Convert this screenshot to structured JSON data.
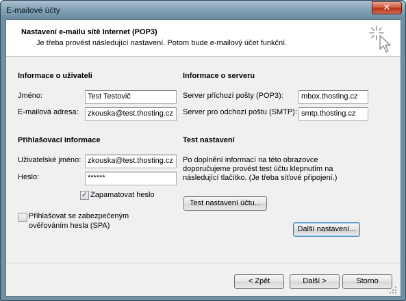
{
  "window": {
    "title": "E-mailové účty",
    "close_label": "✕"
  },
  "header": {
    "title": "Nastavení e-mailu sítě Internet (POP3)",
    "subtitle": "Je třeba provést následující nastavení. Potom bude e-mailový účet funkční."
  },
  "user_info": {
    "heading": "Informace o uživateli",
    "name_label": "Jméno:",
    "name_value": "Test Testovič",
    "email_label": "E-mailová adresa:",
    "email_value": "zkouska@test.thosting.cz"
  },
  "server_info": {
    "heading": "Informace o serveru",
    "incoming_label": "Server příchozí pošty (POP3):",
    "incoming_value": "mbox.thosting.cz",
    "outgoing_label": "Server pro odchozí poštu (SMTP):",
    "outgoing_value": "smtp.thosting.cz"
  },
  "login_info": {
    "heading": "Přihlašovací informace",
    "username_label": "Uživatelské jméno:",
    "username_value": "zkouska@test.thosting.cz",
    "password_label": "Heslo:",
    "password_value": "******",
    "remember_label": "Zapamatovat heslo",
    "remember_checked": true,
    "spa_label_line1": "Přihlašovat se zabezpečeným",
    "spa_label_line2": "ověřováním hesla (SPA)",
    "spa_checked": false
  },
  "test_settings": {
    "heading": "Test nastavení",
    "description_line1": "Po doplnění informací na této obrazovce",
    "description_line2": "doporučujeme provést test účtu klepnutím na",
    "description_line3": "následující tlačítko. (Je třeba síťové připojení.)",
    "test_button_label": "Test nastavení účtu...",
    "more_settings_label": "Další nastavení..."
  },
  "footer": {
    "back_label": "< Zpět",
    "next_label": "Další >",
    "cancel_label": "Storno"
  },
  "colors": {
    "title_bar": "#86a4b7",
    "dialog_bg": "#f0f0f0",
    "header_bg": "#ffffff",
    "close_button": "#d2593f",
    "focus_border": "#3c7fb1"
  }
}
